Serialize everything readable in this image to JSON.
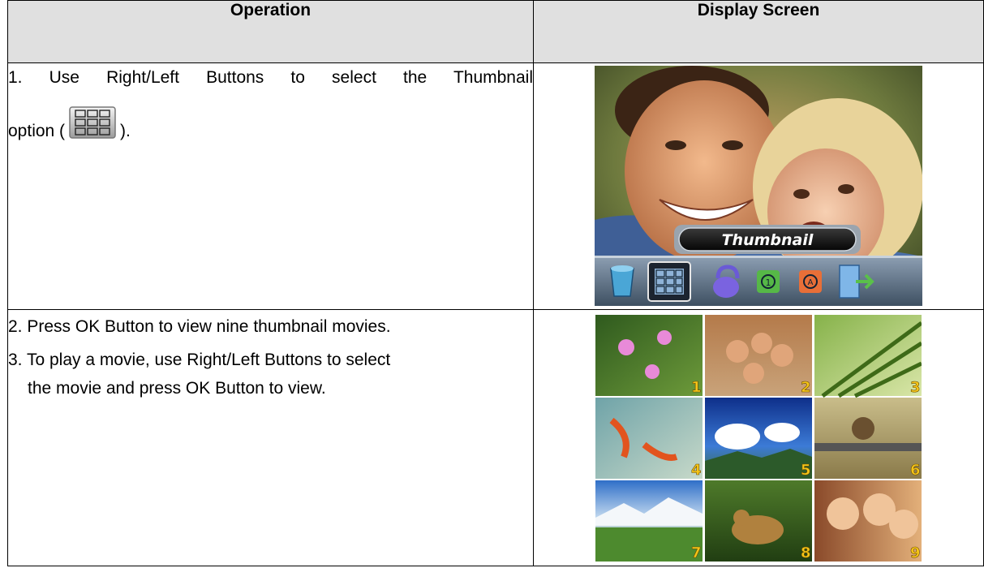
{
  "table": {
    "header_operation": "Operation",
    "header_display": "Display Screen"
  },
  "rows": [
    {
      "op_line1": "1. Use Right/Left Buttons to select the Thumbnail",
      "op_line2_prefix": "option (",
      "op_line2_suffix": ").",
      "icon": "thumbnail-grid-icon",
      "screen_label": "Thumbnail",
      "menu_icons": [
        "trash-icon",
        "thumbnail-grid-icon",
        "lock-icon",
        "rotate-icon",
        "autoplay-icon",
        "exit-door-icon"
      ]
    },
    {
      "step2": "2. Press OK Button to view nine thumbnail movies.",
      "step3_line1": "3. To play a movie, use Right/Left Buttons to select",
      "step3_line2": "the movie and press OK Button to view.",
      "thumb_numbers": [
        "1",
        "2",
        "3",
        "4",
        "5",
        "6",
        "7",
        "8",
        "9"
      ]
    }
  ],
  "colors": {
    "header_bg": "#e0e0e0",
    "label_text": "#ffffff",
    "number_yellow": "#f5c518"
  }
}
